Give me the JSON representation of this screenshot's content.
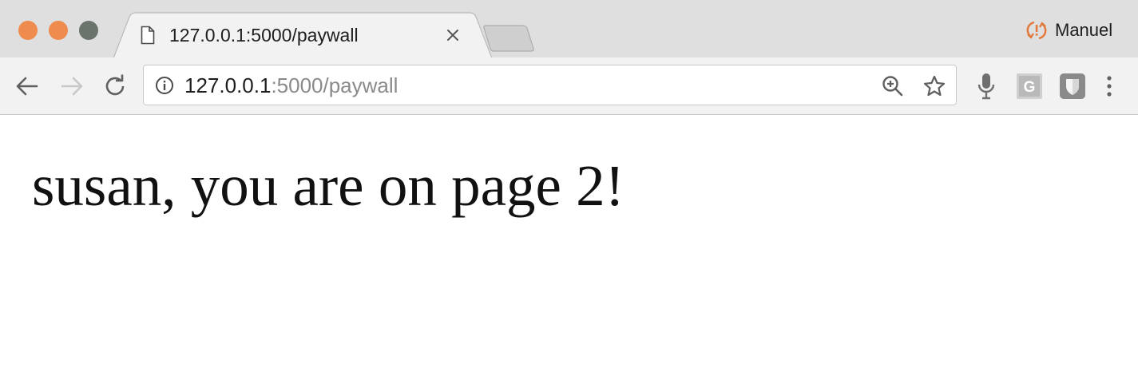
{
  "window": {
    "traffic_lights": {
      "close_color": "#ee8b4d",
      "minimize_color": "#ee8b4d",
      "maximize_color": "#6a736c"
    }
  },
  "tabs": [
    {
      "title": "127.0.0.1:5000/paywall",
      "favicon": "page-icon",
      "close_icon": "close-icon",
      "active": true
    }
  ],
  "profile": {
    "name": "Manuel",
    "icon": "sync-error-icon",
    "icon_color": "#e2793a"
  },
  "toolbar": {
    "back_icon": "arrow-left-icon",
    "forward_icon": "arrow-right-icon",
    "reload_icon": "reload-icon",
    "extensions": [
      "microphone-icon",
      "g-extension-icon",
      "shield-extension-icon"
    ],
    "menu_icon": "kebab-menu-icon"
  },
  "omnibox": {
    "info_icon": "info-icon",
    "url_host": "127.0.0.1",
    "url_rest": ":5000/paywall",
    "zoom_icon": "zoom-in-icon",
    "bookmark_icon": "star-icon"
  },
  "page": {
    "heading": "susan, you are on page 2!"
  }
}
